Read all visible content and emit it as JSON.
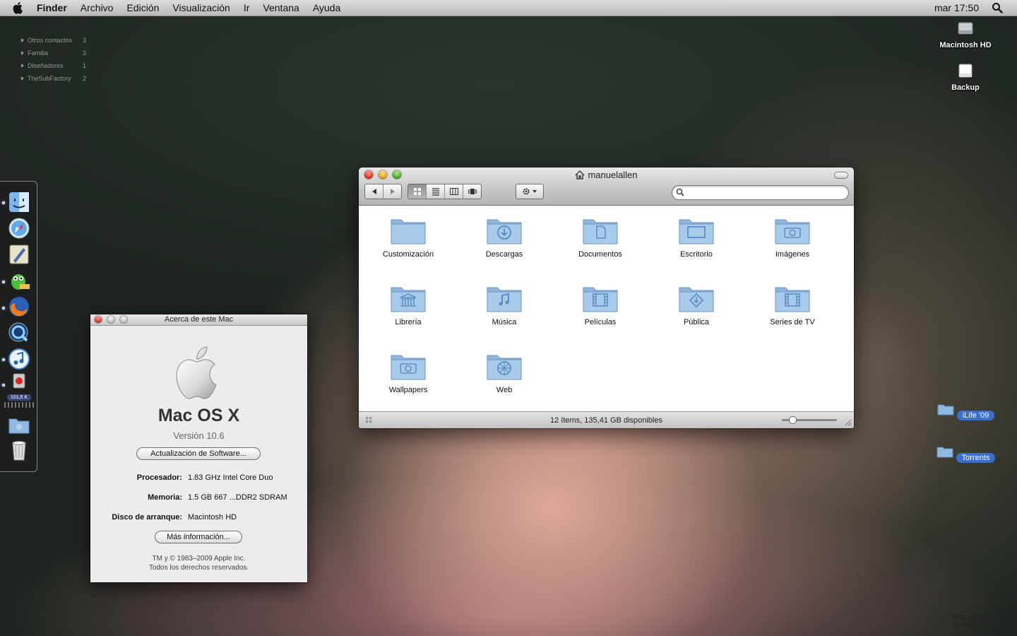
{
  "menubar": {
    "app": "Finder",
    "items": [
      "Archivo",
      "Edición",
      "Visualización",
      "Ir",
      "Ventana",
      "Ayuda"
    ],
    "clock": "mar 17:50"
  },
  "contacts": [
    {
      "name": "Otros contactos",
      "count": "3"
    },
    {
      "name": "Familia",
      "count": "3"
    },
    {
      "name": "Diseñadores",
      "count": "1"
    },
    {
      "name": "TheSubFactory",
      "count": "2"
    }
  ],
  "desktop": {
    "drives": [
      {
        "label": "Macintosh HD",
        "icon": "hard-drive-icon"
      },
      {
        "label": "Backup",
        "icon": "external-drive-icon"
      }
    ],
    "folders": [
      {
        "label": "iLife '09",
        "icon": "folder-icon"
      },
      {
        "label": "Torrents",
        "icon": "folder-icon"
      }
    ],
    "watermark_title": "THE SEED (2.0)",
    "watermark_sub": "THE ROOTS"
  },
  "dock": {
    "items": [
      "finder-icon",
      "safari-icon",
      "mail-icon",
      "adium-icon",
      "firefox-icon",
      "quicktime-icon",
      "itunes-icon",
      "transmission-icon",
      "folder-stack-icon",
      "trash-icon"
    ],
    "badge": "101,6 K"
  },
  "finder": {
    "title": "manuelallen",
    "search_placeholder": "",
    "status": "12 ítems, 135,41 GB disponibles",
    "folders": [
      {
        "label": "Customización",
        "icon": "plain"
      },
      {
        "label": "Descargas",
        "icon": "downloads"
      },
      {
        "label": "Documentos",
        "icon": "document"
      },
      {
        "label": "Escritorio",
        "icon": "desktop"
      },
      {
        "label": "Imágenes",
        "icon": "camera"
      },
      {
        "label": "Librería",
        "icon": "library"
      },
      {
        "label": "Música",
        "icon": "music"
      },
      {
        "label": "Películas",
        "icon": "film"
      },
      {
        "label": "Pública",
        "icon": "public"
      },
      {
        "label": "Series de TV",
        "icon": "film"
      },
      {
        "label": "Wallpapers",
        "icon": "camera"
      },
      {
        "label": "Web",
        "icon": "web"
      }
    ]
  },
  "about": {
    "title": "Acerca de este Mac",
    "os": "Mac OS X",
    "version": "Versión 10.6",
    "update_button": "Actualización de Software...",
    "rows": [
      {
        "key": "Procesador:",
        "value": "1.83 GHz Intel Core Duo"
      },
      {
        "key": "Memoria:",
        "value": "1.5 GB 667 ...DDR2 SDRAM"
      },
      {
        "key": "Disco de arranque:",
        "value": "Macintosh HD"
      }
    ],
    "more_button": "Más información...",
    "copyright_1": "TM y © 1983–2009 Apple Inc.",
    "copyright_2": "Todos los derechos reservados."
  },
  "colors": {
    "accent": "#3a6fd0",
    "folder": "#9fc3e6"
  }
}
